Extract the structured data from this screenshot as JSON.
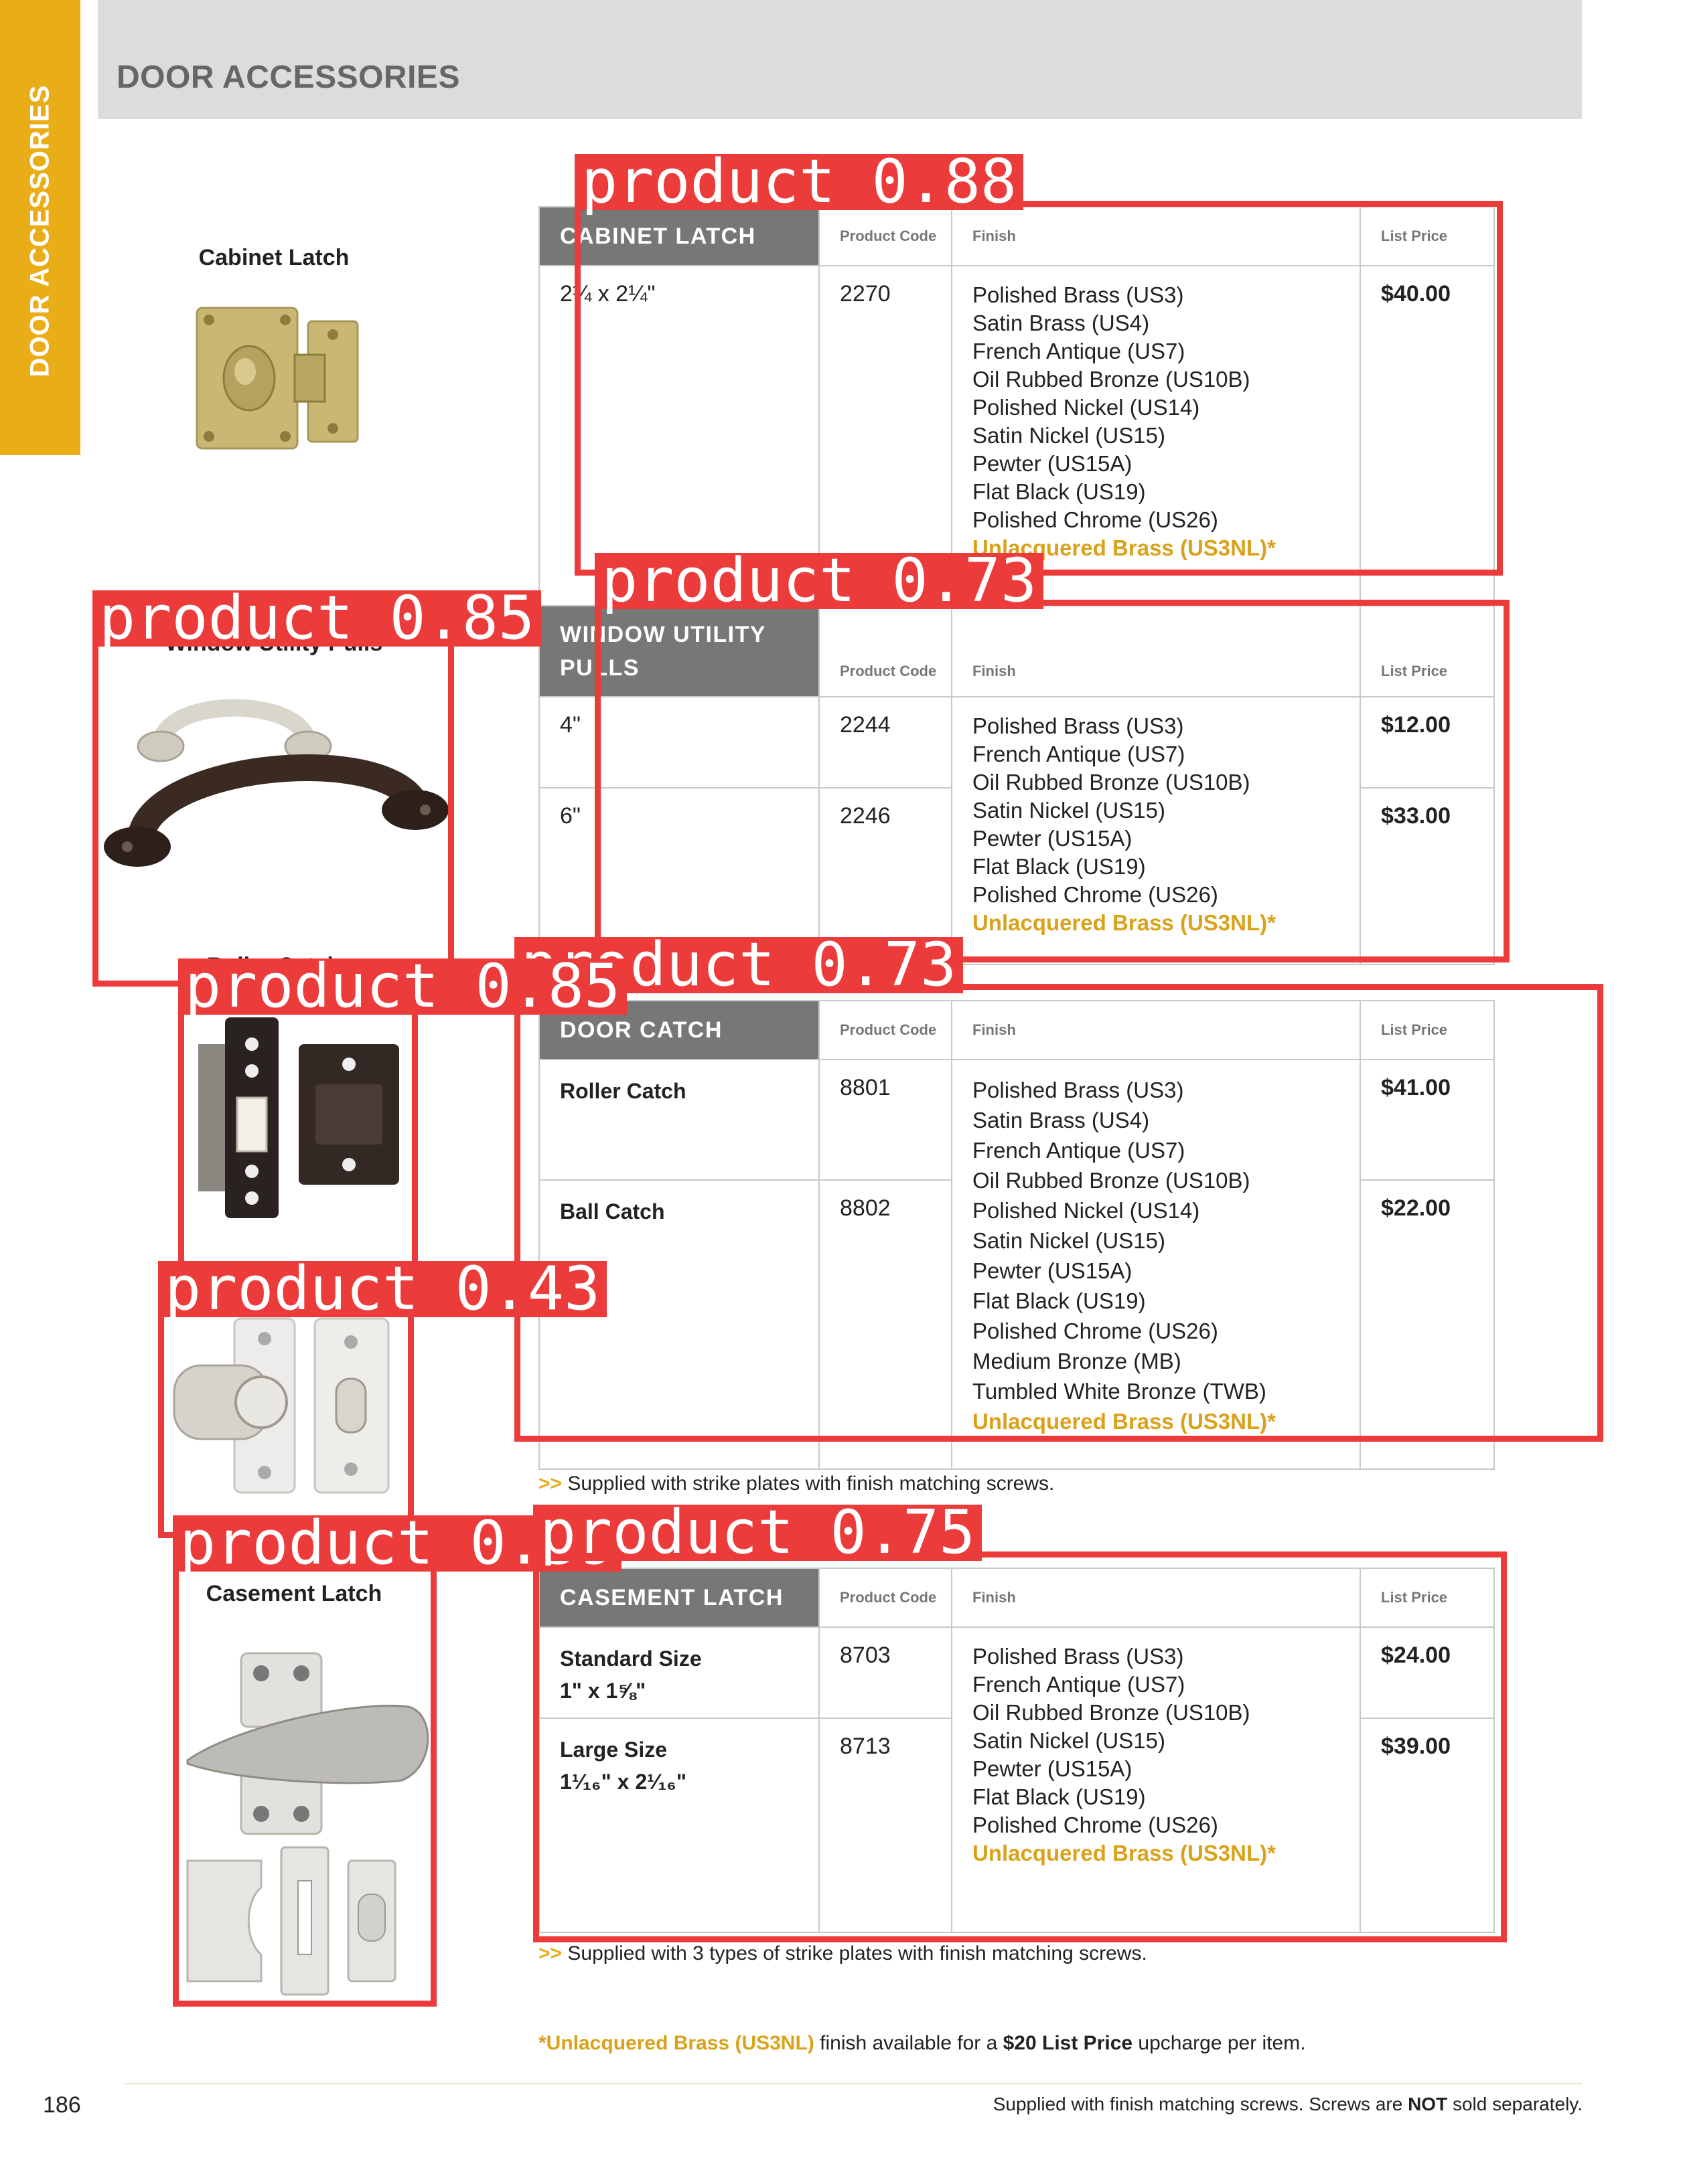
{
  "side_tab": {
    "label": "DOOR ACCESSORIES"
  },
  "header": {
    "title": "DOOR ACCESSORIES"
  },
  "products": [
    {
      "caption": "Cabinet Latch",
      "table": {
        "name": "CABINET LATCH",
        "col_code": "Product Code",
        "col_finish": "Finish",
        "col_price": "List Price",
        "rows": [
          {
            "size": "2¼ x 2¼\"",
            "code": "2270",
            "price": "$40.00"
          }
        ],
        "finishes": [
          "Polished Brass (US3)",
          "Satin Brass (US4)",
          "French Antique (US7)",
          "Oil Rubbed Bronze (US10B)",
          "Polished Nickel (US14)",
          "Satin Nickel (US15)",
          "Pewter (US15A)",
          "Flat Black (US19)",
          "Polished Chrome (US26)"
        ],
        "finish_highlight": "Unlacquered Brass (US3NL)*"
      }
    },
    {
      "caption": "Window Utility Pulls",
      "table": {
        "name": "WINDOW UTILITY PULLS",
        "col_code": "Product Code",
        "col_finish": "Finish",
        "col_price": "List Price",
        "rows": [
          {
            "size": "4\"",
            "code": "2244",
            "price": "$12.00"
          },
          {
            "size": "6\"",
            "code": "2246",
            "price": "$33.00"
          }
        ],
        "finishes": [
          "Polished Brass (US3)",
          "French Antique (US7)",
          "Oil Rubbed Bronze (US10B)",
          "Satin Nickel (US15)",
          "Pewter (US15A)",
          "Flat Black (US19)",
          "Polished Chrome (US26)"
        ],
        "finish_highlight": "Unlacquered Brass (US3NL)*"
      }
    },
    {
      "caption": "Roller Catch",
      "table": {
        "name": "DOOR CATCH",
        "col_code": "Product Code",
        "col_finish": "Finish",
        "col_price": "List Price",
        "rows": [
          {
            "size": "Roller Catch",
            "code": "8801",
            "price": "$41.00"
          },
          {
            "size": "Ball Catch",
            "code": "8802",
            "price": "$22.00"
          }
        ],
        "finishes": [
          "Polished Brass (US3)",
          "Satin Brass (US4)",
          "French Antique (US7)",
          "Oil Rubbed Bronze (US10B)",
          "Polished Nickel (US14)",
          "Satin Nickel (US15)",
          "Pewter (US15A)",
          "Flat Black (US19)",
          "Polished Chrome (US26)",
          "Medium Bronze (MB)",
          "Tumbled White Bronze (TWB)"
        ],
        "finish_highlight": "Unlacquered Brass (US3NL)*"
      },
      "note": "Supplied with strike plates with finish matching screws."
    },
    {
      "caption": "Casement Latch",
      "table": {
        "name": "CASEMENT LATCH",
        "col_code": "Product Code",
        "col_finish": "Finish",
        "col_price": "List Price",
        "rows": [
          {
            "size": "Standard Size",
            "size2": "1\" x 1⅝\"",
            "code": "8703",
            "price": "$24.00"
          },
          {
            "size": "Large Size",
            "size2": "1¹⁄₁₆\" x 2¹⁄₁₆\"",
            "code": "8713",
            "price": "$39.00"
          }
        ],
        "finishes": [
          "Polished Brass (US3)",
          "French Antique (US7)",
          "Oil Rubbed Bronze (US10B)",
          "Satin Nickel (US15)",
          "Pewter (US15A)",
          "Flat Black (US19)",
          "Polished Chrome (US26)"
        ],
        "finish_highlight": "Unlacquered Brass (US3NL)*"
      },
      "note": "Supplied with 3 types of strike plates with finish matching screws."
    }
  ],
  "note_arrow": ">>",
  "footnote": {
    "gold": "*Unlacquered Brass (US3NL)",
    "text1": " finish available for a ",
    "bold": "$20 List Price",
    "text2": " upcharge per item."
  },
  "footer": {
    "page_number": "186",
    "text1": "Supplied with finish matching screws. Screws are ",
    "bold": "NOT",
    "text2": " sold separately."
  },
  "detections": [
    {
      "label": "product 0.88"
    },
    {
      "label": "product 0.73"
    },
    {
      "label": "product 0.85"
    },
    {
      "label": "product 0.73"
    },
    {
      "label": "product 0.85"
    },
    {
      "label": "product 0.43"
    },
    {
      "label": "product 0.59"
    },
    {
      "label": "product 0.75"
    }
  ],
  "colors": {
    "accent": "#e8ad17",
    "highlight_text": "#d9a21a",
    "table_header": "#777777",
    "detection_box": "#ec3b3b"
  }
}
